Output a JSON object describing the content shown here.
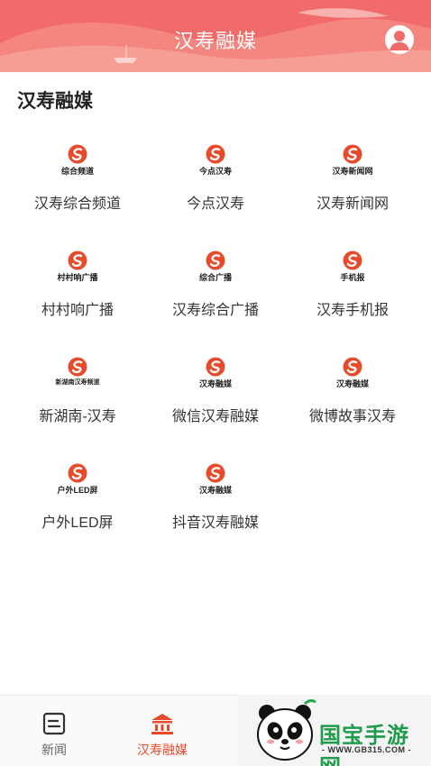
{
  "header": {
    "title": "汉寿融媒",
    "background": "#f26b6b"
  },
  "section": {
    "title": "汉寿融媒"
  },
  "accent": "#e84a2c",
  "items": [
    {
      "logo_text": "综合频道",
      "label": "汉寿综合频道"
    },
    {
      "logo_text": "今点汉寿",
      "label": "今点汉寿"
    },
    {
      "logo_text": "汉寿新闻网",
      "label": "汉寿新闻网"
    },
    {
      "logo_text": "村村响广播",
      "label": "村村响广播"
    },
    {
      "logo_text": "综合广播",
      "label": "汉寿综合广播"
    },
    {
      "logo_text": "手机报",
      "label": "汉寿手机报"
    },
    {
      "logo_text": "新湖南汉寿频道",
      "label": "新湖南-汉寿"
    },
    {
      "logo_text": "汉寿融媒",
      "label": "微信汉寿融媒"
    },
    {
      "logo_text": "汉寿融媒",
      "label": "微博故事汉寿"
    },
    {
      "logo_text": "户外LED屏",
      "label": "户外LED屏"
    },
    {
      "logo_text": "汉寿融媒",
      "label": "抖音汉寿融媒"
    }
  ],
  "bottom_nav": [
    {
      "label": "新闻",
      "icon": "news-icon",
      "active": false
    },
    {
      "label": "汉寿融媒",
      "icon": "building-icon",
      "active": true
    }
  ],
  "watermark": {
    "text": "国宝手游网",
    "url": "- WWW.GB315.COM -"
  }
}
